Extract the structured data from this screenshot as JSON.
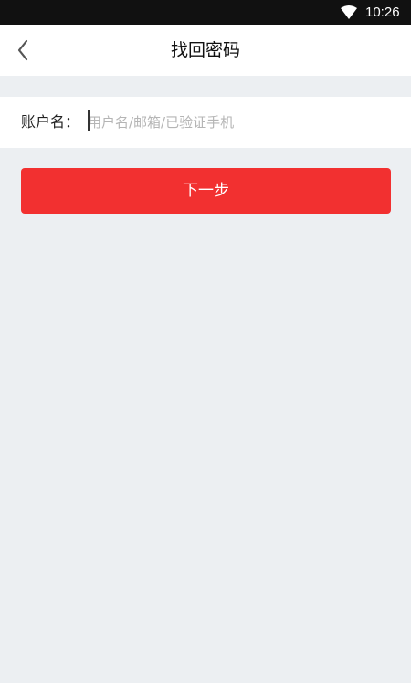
{
  "status_bar": {
    "time": "10:26",
    "wifi_icon": "wifi-icon"
  },
  "nav": {
    "back_icon": "chevron-left-icon",
    "title": "找回密码"
  },
  "form": {
    "account_label": "账户名：",
    "account_placeholder": "用户名/邮箱/已验证手机",
    "account_value": ""
  },
  "actions": {
    "next_label": "下一步"
  },
  "colors": {
    "status_bar_bg": "#111111",
    "page_bg": "#ECEFF2",
    "accent": "#F23030",
    "placeholder": "#B5B5B5"
  }
}
